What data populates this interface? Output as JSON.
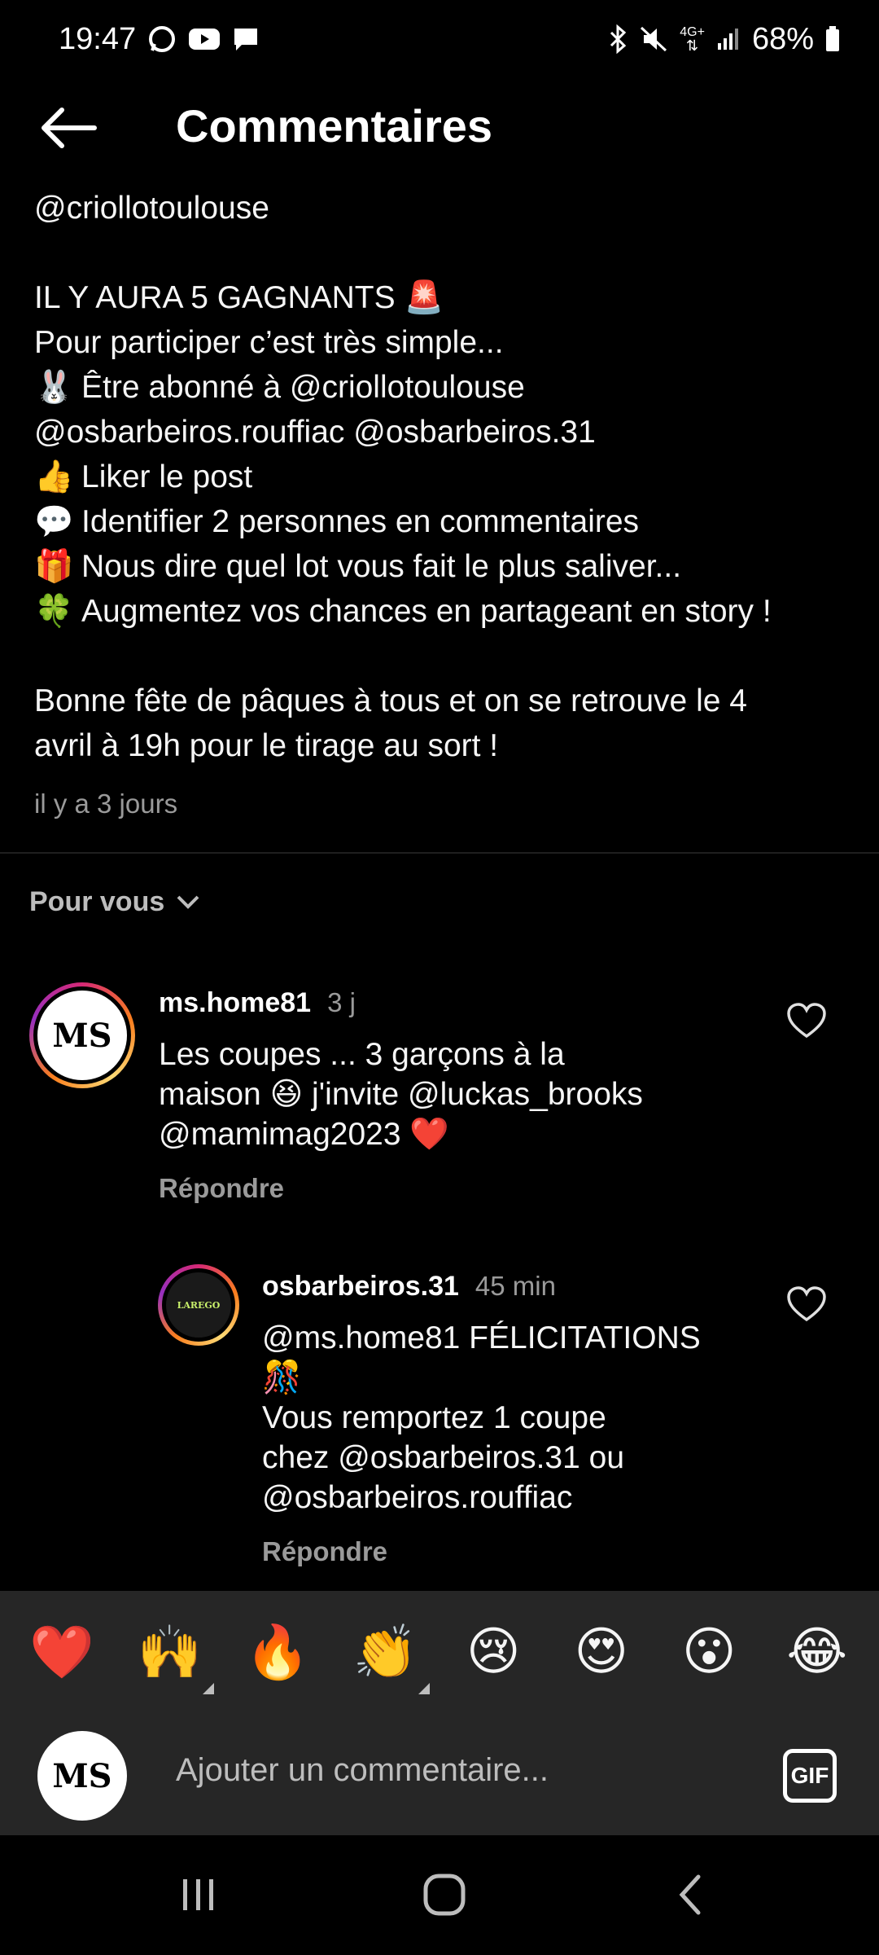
{
  "status_bar": {
    "time": "19:47",
    "battery": "68%",
    "network": "4G+",
    "left_icons": [
      "whatsapp-icon",
      "youtube-icon",
      "message-icon"
    ],
    "right_icons": [
      "bluetooth-icon",
      "mute-icon",
      "signal-icon",
      "battery-icon"
    ]
  },
  "header": {
    "title": "Commentaires",
    "back_icon": "arrow-left-icon"
  },
  "caption": {
    "lines": [
      {
        "emoji": "",
        "text": "@criollotoulouse"
      },
      {
        "emoji": "",
        "text": ""
      },
      {
        "emoji": "",
        "text": "IL Y AURA 5 GAGNANTS 🚨"
      },
      {
        "emoji": "",
        "text": "Pour participer c’est très simple..."
      },
      {
        "emoji": "🐰",
        "text": "Être abonné à @criollotoulouse"
      },
      {
        "emoji": "",
        "text": "@osbarbeiros.rouffiac @osbarbeiros.31"
      },
      {
        "emoji": "👍",
        "text": "Liker le post"
      },
      {
        "emoji": "💬",
        "text": "Identifier 2 personnes en commentaires"
      },
      {
        "emoji": "🎁",
        "text": "Nous dire quel lot vous fait le plus saliver..."
      },
      {
        "emoji": "🍀",
        "text": "Augmentez vos chances en partageant en story !"
      },
      {
        "emoji": "",
        "text": ""
      },
      {
        "emoji": "",
        "text": "Bonne fête de pâques à tous et on se retrouve le 4"
      },
      {
        "emoji": "",
        "text": "avril à 19h pour le tirage au sort !"
      }
    ],
    "time": "il y a 3 jours"
  },
  "filter": {
    "label": "Pour vous",
    "icon": "chevron-down-icon"
  },
  "comments": [
    {
      "user": "ms.home81",
      "time": "3 j",
      "lines": [
        "Les coupes ... 3 garçons à la",
        "maison 😆 j'invite @luckas_brooks",
        "@mamimag2023 ❤️"
      ],
      "reply": "Répondre",
      "avatar_text": "MS"
    },
    {
      "user": "osbarbeiros.31",
      "time": "45 min",
      "lines": [
        "@ms.home81 FÉLICITATIONS",
        "🎊",
        "Vous remportez 1 coupe",
        "chez @osbarbeiros.31 ou",
        "@osbarbeiros.rouffiac"
      ],
      "reply": "Répondre",
      "avatar_text": "LAREGO"
    }
  ],
  "emoji_bar": [
    "❤️",
    "🙌",
    "🔥",
    "👏",
    "😢",
    "😍",
    "😮",
    "😂"
  ],
  "composer": {
    "placeholder": "Ajouter un commentaire...",
    "gif_label": "GIF",
    "avatar_text": "MS"
  },
  "nav_bar": {
    "icons": [
      "recents-icon",
      "home-icon",
      "back-icon"
    ]
  }
}
